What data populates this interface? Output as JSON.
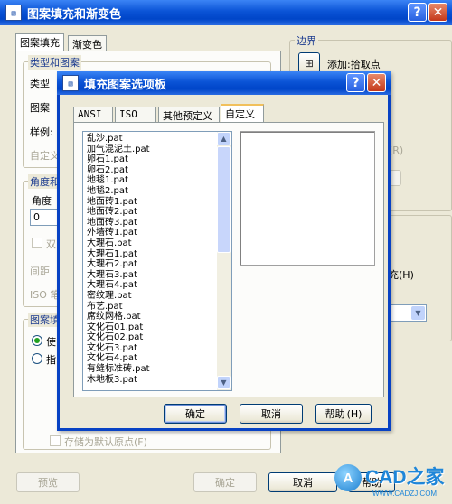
{
  "main_dialog": {
    "title": "图案填充和渐变色",
    "icon_text": "▧",
    "tabs": [
      "图案填充",
      "渐变色"
    ],
    "type_group_label": "类型和图案",
    "type_label": "类型",
    "pattern_label": "图案",
    "sample_label": "样例:",
    "custom_label": "自定义",
    "angle_group_label": "角度和",
    "angle_label": "角度",
    "angle_value": "0",
    "double_label": "双",
    "spacing_label": "间距",
    "iso_label": "ISO 笔",
    "origin_group_label": "图案填",
    "use_current_label": "使",
    "specify_label": "指",
    "store_default_label": "存储为默认原点",
    "store_default_hotkey": "(F)",
    "boundary_label": "边界",
    "add_pick_label": "添加:拾取点",
    "fill_label": "充",
    "fill_hotkey": "(H)",
    "hotkey_r": "(R)",
    "preview_button": "预览",
    "ok_button": "确定",
    "cancel_button": "取消",
    "help_button": "帮助"
  },
  "palette_dialog": {
    "title": "填充图案选项板",
    "tabs": [
      "ANSI",
      "ISO",
      "其他预定义",
      "自定义"
    ],
    "active_tab": "自定义",
    "patterns": [
      "乱沙.pat",
      "加气混泥土.pat",
      "卵石1.pat",
      "卵石2.pat",
      "地毯1.pat",
      "地毯2.pat",
      "地面砖1.pat",
      "地面砖2.pat",
      "地面砖3.pat",
      "外墙砖1.pat",
      "大理石.pat",
      "大理石1.pat",
      "大理石2.pat",
      "大理石3.pat",
      "大理石4.pat",
      "密纹理.pat",
      "布艺.pat",
      "席纹网格.pat",
      "文化石01.pat",
      "文化石02.pat",
      "文化石3.pat",
      "文化石4.pat",
      "有缝标准砖.pat",
      "木地板3.pat"
    ],
    "ok_button": "确定",
    "cancel_button": "取消",
    "help_button": "帮助",
    "help_hotkey": "(H)"
  },
  "watermark": {
    "logo_text": "CAD之家",
    "url": "WWW.CADZJ.COM"
  }
}
